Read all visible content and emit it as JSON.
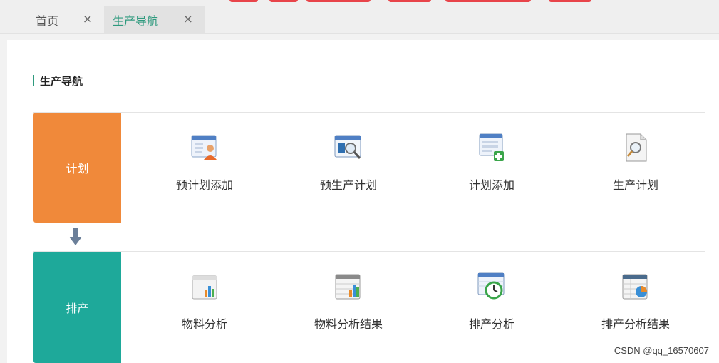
{
  "tabs": [
    {
      "label": "首页",
      "close": "×"
    },
    {
      "label": "生产导航",
      "close": "×"
    }
  ],
  "section": {
    "title": "生产导航"
  },
  "rows": [
    {
      "category": "计划",
      "color": "#f0893a",
      "items": [
        {
          "label": "预计划添加",
          "icon": "user-form-icon"
        },
        {
          "label": "预生产计划",
          "icon": "search-window-icon"
        },
        {
          "label": "计划添加",
          "icon": "add-list-icon"
        },
        {
          "label": "生产计划",
          "icon": "document-search-icon"
        }
      ]
    },
    {
      "category": "排产",
      "color": "#1ea99a",
      "items": [
        {
          "label": "物料分析",
          "icon": "bar-chart-icon"
        },
        {
          "label": "物料分析结果",
          "icon": "table-chart-icon"
        },
        {
          "label": "排产分析",
          "icon": "calendar-clock-icon"
        },
        {
          "label": "排产分析结果",
          "icon": "table-pie-icon"
        }
      ]
    }
  ],
  "watermark": "CSDN @qq_16570607"
}
